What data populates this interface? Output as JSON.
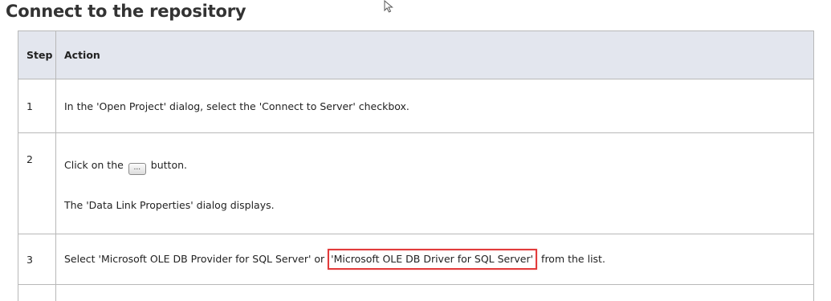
{
  "page": {
    "title": "Connect to the repository"
  },
  "table": {
    "headers": {
      "step": "Step",
      "action": "Action"
    },
    "rows": [
      {
        "step": "1",
        "action": "In the 'Open Project' dialog, select the 'Connect to Server' checkbox."
      },
      {
        "step": "2",
        "action_before": "Click on the",
        "button_glyph": "...",
        "action_after": "button.",
        "note": "The 'Data Link Properties' dialog displays."
      },
      {
        "step": "3",
        "action_before": "Select 'Microsoft OLE DB Provider for SQL Server' or",
        "action_highlight": "'Microsoft OLE DB Driver for SQL Server'",
        "action_after": "from the list."
      }
    ]
  },
  "icons": {
    "cursor": "mouse-pointer-icon",
    "ellipsis": "ellipsis-button-icon"
  },
  "colors": {
    "header_bg": "#e3e6ee",
    "border": "#b8b8b8",
    "highlight": "#e23b3b",
    "title": "#333333"
  }
}
